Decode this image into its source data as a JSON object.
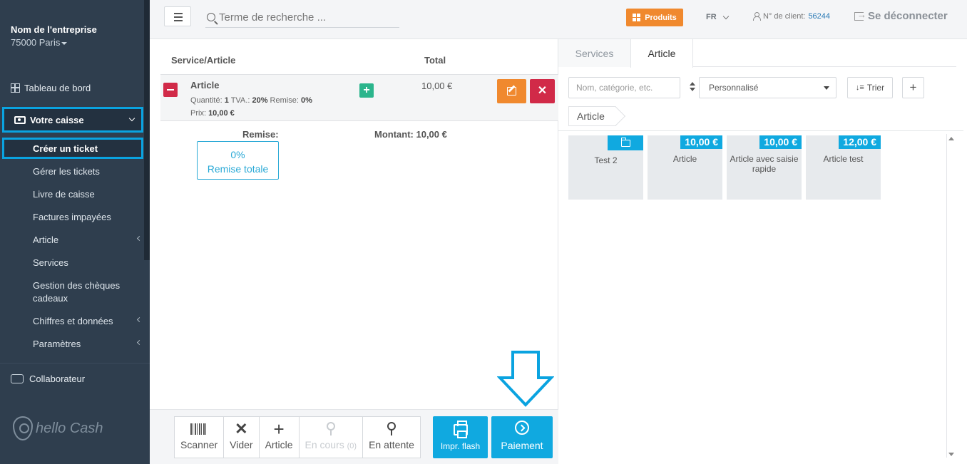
{
  "sidebar": {
    "company_name": "Nom de l'entreprise",
    "company_city": "75000 Paris",
    "dashboard": "Tableau de bord",
    "caisse": "Votre caisse",
    "items": [
      {
        "label": "Créer un ticket"
      },
      {
        "label": "Gérer les tickets"
      },
      {
        "label": "Livre de caisse"
      },
      {
        "label": "Factures impayées"
      },
      {
        "label": "Article"
      },
      {
        "label": "Services"
      },
      {
        "label": "Gestion des chèques cadeaux"
      },
      {
        "label": "Chiffres et données"
      },
      {
        "label": "Paramètres"
      }
    ],
    "collaborateur": "Collaborateur",
    "logo_text": "hello Cash"
  },
  "topbar": {
    "search_placeholder": "Terme de recherche ...",
    "produits": "Produits",
    "lang": "FR",
    "client_label": "N° de client:",
    "client_number": "56244",
    "logout": "Se déconnecter"
  },
  "ticket": {
    "col_service": "Service/Article",
    "col_total": "Total",
    "item": {
      "title": "Article",
      "qty_label": "Quantité:",
      "qty": "1",
      "tva_label": "TVA.:",
      "tva": "20%",
      "remise_label": "Remise:",
      "remise": "0%",
      "prix_label": "Prix:",
      "prix": "10,00 €",
      "total": "10,00 €"
    },
    "remise_label": "Remise:",
    "montant": "Montant: 10,00 €",
    "remise_btn_pct": "0%",
    "remise_btn_text": "Remise totale"
  },
  "actions": {
    "scanner": "Scanner",
    "vider": "Vider",
    "article": "Article",
    "en_cours": "En cours",
    "en_cours_count": "(0)",
    "en_attente": "En attente",
    "flash": "Impr. flash",
    "paiement": "Paiement"
  },
  "panel": {
    "tab_services": "Services",
    "tab_article": "Article",
    "filter_placeholder": "Nom, catégorie, etc.",
    "select_value": "Personnalisé",
    "trier": "Trier",
    "breadcrumb": "Article",
    "tiles": [
      {
        "label": "Test 2",
        "price": ""
      },
      {
        "label": "Article",
        "price": "10,00 €"
      },
      {
        "label": "Article avec saisie rapide",
        "price": "10,00 €"
      },
      {
        "label": "Article test",
        "price": "12,00 €"
      }
    ]
  },
  "colors": {
    "sidebar_bg": "#2f3e4e",
    "accent_blue": "#10a9e0",
    "orange": "#f0892e",
    "red": "#d12a48",
    "green": "#2bb58c"
  }
}
